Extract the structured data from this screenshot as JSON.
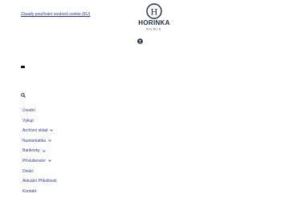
{
  "notice": {
    "text": "Zásady používání souborů cookie (EU)"
  },
  "logo": {
    "name": "HORINKA",
    "tagline": "NUMIS",
    "letter": "H"
  },
  "colors": {
    "brand": "#2b3a8f",
    "text": "#1f2a44",
    "background": "#ffffff"
  },
  "icons": {
    "account": "user-circle-icon",
    "menu_toggle": "menu-toggle-icon",
    "search": "search-icon",
    "submenu": "chevron-down-icon"
  },
  "nav": {
    "items": [
      {
        "label": "Úvodní",
        "has_submenu": false
      },
      {
        "label": "Výkup",
        "has_submenu": false
      },
      {
        "label": "Archívní sklad",
        "has_submenu": true
      },
      {
        "label": "Numismatika",
        "has_submenu": true
      },
      {
        "label": "Bankovky",
        "has_submenu": true
      },
      {
        "label": "Příslušenství",
        "has_submenu": true
      },
      {
        "label": "Diváci",
        "has_submenu": false
      },
      {
        "label": "Aktuální Příležitosti",
        "has_submenu": false
      },
      {
        "label": "Kontakt",
        "has_submenu": false
      }
    ]
  }
}
